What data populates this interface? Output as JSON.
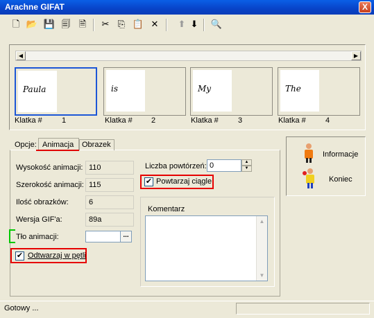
{
  "window": {
    "title": "Arachne GIFAT",
    "close_glyph": "X"
  },
  "toolbar": [
    {
      "icon": "new-icon",
      "glyph": "🗋",
      "enabled": true
    },
    {
      "icon": "open-icon",
      "glyph": "📂",
      "enabled": true
    },
    {
      "icon": "save-icon",
      "glyph": "💾",
      "enabled": false
    },
    {
      "icon": "save-all-icon",
      "glyph": "🗐",
      "enabled": true
    },
    {
      "icon": "add-frame-icon",
      "glyph": "🗎",
      "enabled": true
    },
    {
      "icon": "cut-icon",
      "glyph": "✂",
      "enabled": true
    },
    {
      "icon": "copy-icon",
      "glyph": "⎘",
      "enabled": true
    },
    {
      "icon": "paste-icon",
      "glyph": "📋",
      "enabled": true
    },
    {
      "icon": "delete-icon",
      "glyph": "✕",
      "enabled": true
    },
    {
      "icon": "move-up-icon",
      "glyph": "⬆",
      "enabled": false
    },
    {
      "icon": "move-down-icon",
      "glyph": "⬇",
      "enabled": true
    },
    {
      "icon": "preview-icon",
      "glyph": "🔍",
      "enabled": true
    }
  ],
  "frames": [
    {
      "label": "Klatka #",
      "number": "1",
      "text": "Paula",
      "selected": true
    },
    {
      "label": "Klatka #",
      "number": "2",
      "text": "is",
      "selected": false
    },
    {
      "label": "Klatka #",
      "number": "3",
      "text": "My",
      "selected": false
    },
    {
      "label": "Klatka #",
      "number": "4",
      "text": "The",
      "selected": false
    }
  ],
  "tabs": {
    "prefix": "Opcje:",
    "active": "Animacja",
    "other": "Obrazek"
  },
  "animation": {
    "height_label": "Wysokość animacji:",
    "height_value": "110",
    "width_label": "Szerokość animacji:",
    "width_value": "115",
    "count_label": "Ilość obrazków:",
    "count_value": "6",
    "gif_label": "Wersja GIF'a:",
    "gif_value": "89a",
    "bg_label": "Tło animacji:",
    "bg_button": "...",
    "loop_label": "Odtwarzaj w pętli",
    "loop_checked": true,
    "repeat_label": "Liczba powtórzeń:",
    "repeat_value": "0",
    "continuous_label": "Powtarzaj ciągle",
    "continuous_checked": true,
    "comment_label": "Komentarz",
    "comment_value": ""
  },
  "right_panel": {
    "info_label": "Informacje",
    "exit_label": "Koniec"
  },
  "status": {
    "text": "Gotowy ..."
  }
}
